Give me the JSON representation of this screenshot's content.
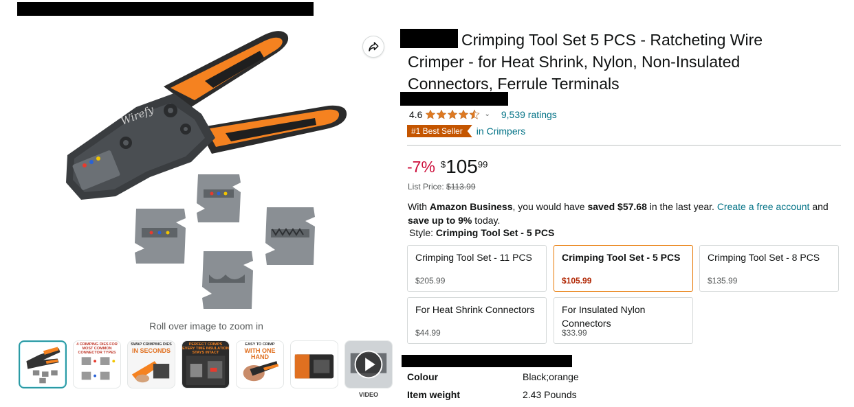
{
  "gallery": {
    "zoom_hint": "Roll over image to zoom in",
    "tool_brand_mark": "Wirefy",
    "thumbnails": [
      {
        "name": "thumb-main-tool-set",
        "caption": ""
      },
      {
        "name": "thumb-crimping-dies",
        "caption": "4 CRIMPING DIES FOR MOST COMMON CONNECTOR TYPES"
      },
      {
        "name": "thumb-swap-dies",
        "caption": "SWAP CRIMPING DIES",
        "caption_big": "IN SECONDS"
      },
      {
        "name": "thumb-perfect-crimps",
        "caption": "PERFECT CRIMPS EVERY TIME INSULATION STAYS INTACT"
      },
      {
        "name": "thumb-easy-crimp",
        "caption": "EASY TO CRIMP",
        "caption_big": "WITH ONE HAND"
      },
      {
        "name": "thumb-case",
        "caption": ""
      },
      {
        "name": "thumb-video",
        "caption": ""
      }
    ],
    "video_label": "VIDEO"
  },
  "product": {
    "title": "Crimping Tool Set 5 PCS - Ratcheting Wire Crimper - for Heat Shrink, Nylon, Non-Insulated Connectors, Ferrule Terminals",
    "rating_value": "4.6",
    "rating_fraction": 0.92,
    "ratings_count": "9,539 ratings",
    "rating_caret": "⌄",
    "bestseller_badge": "#1 Best Seller",
    "bestseller_category": "in Crimpers",
    "discount": "-7%",
    "price_symbol": "$",
    "price_whole": "105",
    "price_fraction": "99",
    "list_price_label": "List Price:",
    "list_price_value": "$113.99",
    "business": {
      "prefix": "With ",
      "bold1": "Amazon Business",
      "mid1": ", you would have ",
      "bold2": "saved $57.68",
      "mid2": " in the last year. ",
      "link": "Create a free account",
      "mid3": " and ",
      "bold3": "save up to 9%",
      "suffix": " today."
    },
    "style_label": "Style:",
    "style_value": "Crimping Tool Set - 5 PCS",
    "variants": [
      {
        "label": "Crimping Tool Set - 11 PCS",
        "price": "$205.99",
        "selected": false
      },
      {
        "label": "Crimping Tool Set - 5 PCS",
        "price": "$105.99",
        "selected": true
      },
      {
        "label": "Crimping Tool Set - 8 PCS",
        "price": "$135.99",
        "selected": false
      },
      {
        "label": "For Heat Shrink Connectors",
        "price": "$44.99",
        "selected": false
      },
      {
        "label": "For Insulated Nylon Connectors",
        "price": "$33.99",
        "selected": false
      }
    ],
    "specs": [
      {
        "label": "Colour",
        "value": "Black;orange"
      },
      {
        "label": "Item weight",
        "value": "2.43 Pounds"
      }
    ]
  },
  "colors": {
    "accent_orange": "#e77600",
    "tool_orange": "#f58220",
    "link_teal": "#007185",
    "discount_red": "#cc0c39",
    "bestseller_orange": "#c45500",
    "star_orange": "#de7921"
  }
}
